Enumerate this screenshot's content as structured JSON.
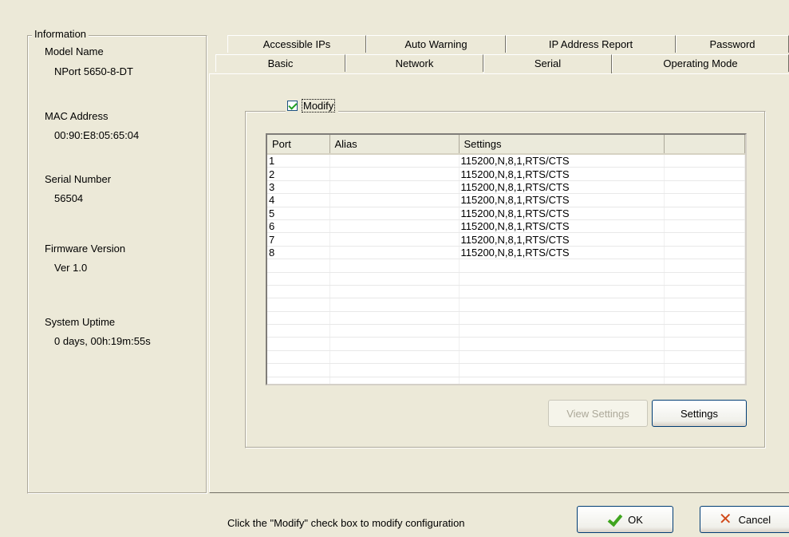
{
  "info": {
    "legend": "Information",
    "model_name_label": "Model Name",
    "model_name_value": "NPort 5650-8-DT",
    "mac_label": "MAC Address",
    "mac_value": "00:90:E8:05:65:04",
    "serial_label": "Serial Number",
    "serial_value": "56504",
    "firmware_label": "Firmware Version",
    "firmware_value": "Ver 1.0",
    "uptime_label": "System Uptime",
    "uptime_value": "0 days, 00h:19m:55s"
  },
  "tabs": {
    "row1": [
      "Accessible IPs",
      "Auto Warning",
      "IP Address Report",
      "Password"
    ],
    "row2": [
      "Basic",
      "Network",
      "Serial",
      "Operating Mode"
    ],
    "active": "Serial"
  },
  "modify": {
    "label": "Modify",
    "checked": true
  },
  "table": {
    "headers": [
      "Port",
      "Alias",
      "Settings",
      ""
    ],
    "rows": [
      [
        "1",
        "",
        "115200,N,8,1,RTS/CTS",
        ""
      ],
      [
        "2",
        "",
        "115200,N,8,1,RTS/CTS",
        ""
      ],
      [
        "3",
        "",
        "115200,N,8,1,RTS/CTS",
        ""
      ],
      [
        "4",
        "",
        "115200,N,8,1,RTS/CTS",
        ""
      ],
      [
        "5",
        "",
        "115200,N,8,1,RTS/CTS",
        ""
      ],
      [
        "6",
        "",
        "115200,N,8,1,RTS/CTS",
        ""
      ],
      [
        "7",
        "",
        "115200,N,8,1,RTS/CTS",
        ""
      ],
      [
        "8",
        "",
        "115200,N,8,1,RTS/CTS",
        ""
      ],
      [
        "",
        "",
        "",
        ""
      ],
      [
        "",
        "",
        "",
        ""
      ],
      [
        "",
        "",
        "",
        ""
      ],
      [
        "",
        "",
        "",
        ""
      ],
      [
        "",
        "",
        "",
        ""
      ],
      [
        "",
        "",
        "",
        ""
      ],
      [
        "",
        "",
        "",
        ""
      ],
      [
        "",
        "",
        "",
        ""
      ],
      [
        "",
        "",
        "",
        ""
      ],
      [
        "",
        "",
        "",
        ""
      ]
    ]
  },
  "buttons": {
    "view_settings": "View Settings",
    "settings": "Settings",
    "ok": "OK",
    "cancel": "Cancel"
  },
  "status": "Click the \"Modify\" check box to modify configuration"
}
